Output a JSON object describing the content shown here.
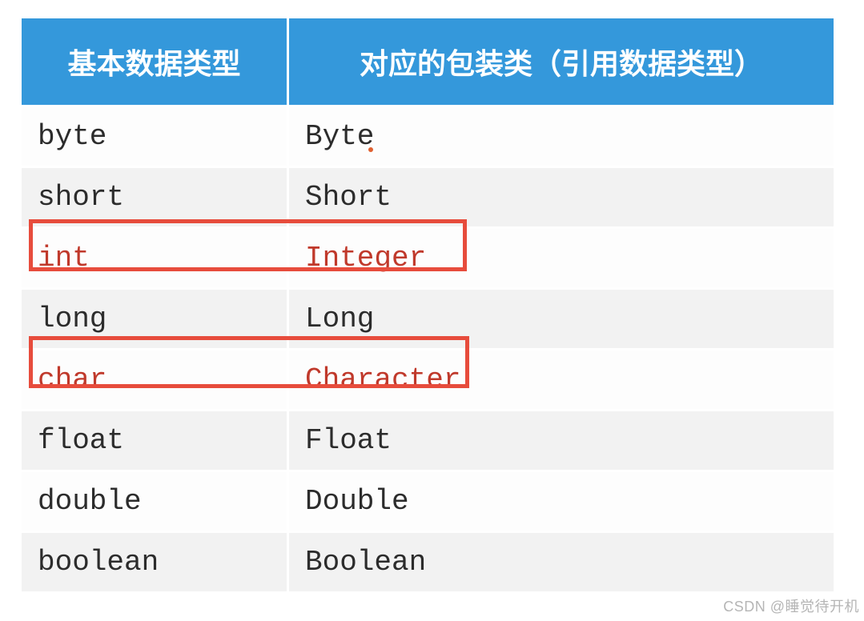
{
  "table": {
    "headers": [
      "基本数据类型",
      "对应的包装类（引用数据类型）"
    ],
    "rows": [
      {
        "primitive": "byte",
        "wrapper": "Byte",
        "highlighted": false
      },
      {
        "primitive": "short",
        "wrapper": "Short",
        "highlighted": false
      },
      {
        "primitive": "int",
        "wrapper": "Integer",
        "highlighted": true
      },
      {
        "primitive": "long",
        "wrapper": "Long",
        "highlighted": false
      },
      {
        "primitive": "char",
        "wrapper": "Character",
        "highlighted": true
      },
      {
        "primitive": "float",
        "wrapper": "Float",
        "highlighted": false
      },
      {
        "primitive": "double",
        "wrapper": "Double",
        "highlighted": false
      },
      {
        "primitive": "boolean",
        "wrapper": "Boolean",
        "highlighted": false
      }
    ]
  },
  "watermark": "CSDN @睡觉待开机",
  "colors": {
    "header_bg": "#3498db",
    "highlight_border": "#e74c3c",
    "highlight_text": "#c0392b"
  }
}
